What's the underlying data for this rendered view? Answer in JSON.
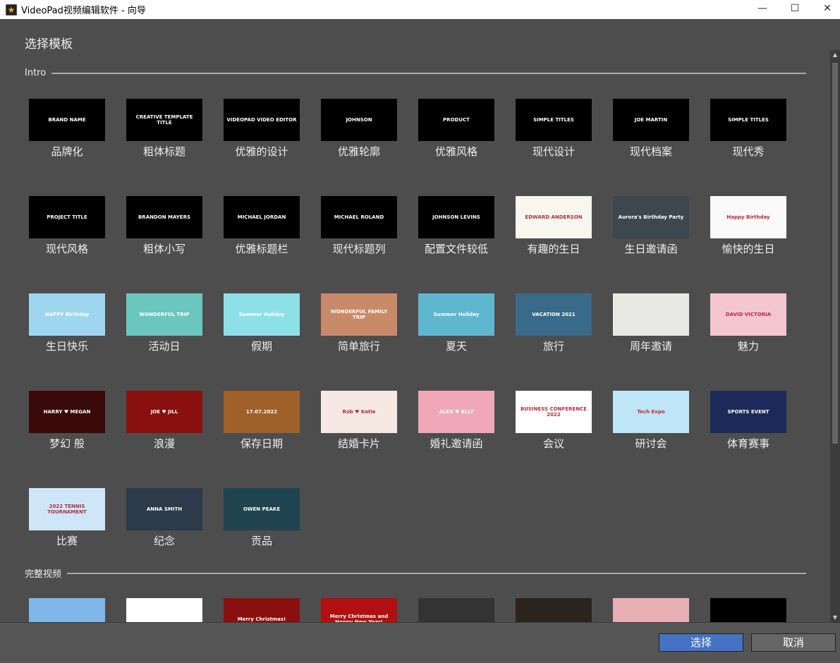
{
  "window": {
    "title": "VideoPad视频编辑软件 - 向导",
    "minimize": "—",
    "maximize": "☐",
    "close": "✕"
  },
  "heading": "选择模板",
  "sections": [
    {
      "label": "Intro"
    },
    {
      "label": "完整视频"
    }
  ],
  "intro": [
    {
      "label": "品牌化",
      "text": "BRAND NAME",
      "bg": "#000"
    },
    {
      "label": "粗体标题",
      "text": "CREATIVE TEMPLATE TITLE",
      "bg": "#000"
    },
    {
      "label": "优雅的设计",
      "text": "VIDEOPAD VIDEO EDITOR",
      "bg": "#000"
    },
    {
      "label": "优雅轮廓",
      "text": "JOHNSON",
      "bg": "#000"
    },
    {
      "label": "优雅风格",
      "text": "PRODUCT",
      "bg": "#000"
    },
    {
      "label": "现代设计",
      "text": "SIMPLE TITLES",
      "bg": "#000"
    },
    {
      "label": "现代档案",
      "text": "JOE MARTIN",
      "bg": "#000"
    },
    {
      "label": "现代秀",
      "text": "SIMPLE TITLES",
      "bg": "#000"
    },
    {
      "label": "现代风格",
      "text": "PROJECT TITLE",
      "bg": "#000"
    },
    {
      "label": "粗体小写",
      "text": "BRANDON MAYERS",
      "bg": "#000"
    },
    {
      "label": "优雅标题栏",
      "text": "MICHAEL JORDAN",
      "bg": "#000"
    },
    {
      "label": "现代标题列",
      "text": "MICHAEL ROLAND",
      "bg": "#000"
    },
    {
      "label": "配置文件较低",
      "text": "JOHNSON LEVINS",
      "bg": "#000"
    },
    {
      "label": "有趣的生日",
      "text": "EDWARD ANDERSON",
      "bg": "#f7f7f0"
    },
    {
      "label": "生日邀请函",
      "text": "Aurora's Birthday Party",
      "bg": "#3d4750"
    },
    {
      "label": "愉快的生日",
      "text": "Happy Birthday",
      "bg": "#fafafa"
    },
    {
      "label": "生日快乐",
      "text": "HAPPY Birthday",
      "bg": "#9fd6ef"
    },
    {
      "label": "活动日",
      "text": "WONDERFUL TRIP",
      "bg": "#6cc6c0"
    },
    {
      "label": "假期",
      "text": "Summer Holiday",
      "bg": "#8ee0e8"
    },
    {
      "label": "简单旅行",
      "text": "WONDERFUL FAMILY TRIP",
      "bg": "#c98a6a"
    },
    {
      "label": "夏天",
      "text": "Summer Holiday",
      "bg": "#5fb6cf"
    },
    {
      "label": "旅行",
      "text": "VACATION 2021",
      "bg": "#3a6a8a"
    },
    {
      "label": "周年邀请",
      "text": "",
      "bg": "#e8e8e4"
    },
    {
      "label": "魅力",
      "text": "DAVID VICTORIA",
      "bg": "#f4c6cf"
    },
    {
      "label": "梦幻 般",
      "text": "HARRY ♥ MEGAN",
      "bg": "#3a0a0a"
    },
    {
      "label": "浪漫",
      "text": "JOE ♥ JILL",
      "bg": "#8a0f0f"
    },
    {
      "label": "保存日期",
      "text": "17.07.2022",
      "bg": "#a0602a"
    },
    {
      "label": "结婚卡片",
      "text": "Rob ♥ Katie",
      "bg": "#f6e9e4"
    },
    {
      "label": "婚礼邀请函",
      "text": "ALEX ♥ ELLY",
      "bg": "#f0a8b8"
    },
    {
      "label": "会议",
      "text": "BUSINESS CONFERENCE 2022",
      "bg": "#ffffff"
    },
    {
      "label": "研讨会",
      "text": "Tech Expo",
      "bg": "#bfe6f6"
    },
    {
      "label": "体育赛事",
      "text": "SPORTS EVENT",
      "bg": "#1c2a5a"
    },
    {
      "label": "比赛",
      "text": "2022 TENNIS TOURNAMENT",
      "bg": "#cfe6f8"
    },
    {
      "label": "纪念",
      "text": "ANNA SMITH",
      "bg": "#2c3a4a"
    },
    {
      "label": "贡品",
      "text": "OWEN PEAKE",
      "bg": "#1f4450"
    }
  ],
  "full": [
    {
      "bg": "#7fb8e8"
    },
    {
      "bg": "#ffffff"
    },
    {
      "bg": "#8a0f0f",
      "text": "Merry Christmas!"
    },
    {
      "bg": "#b01010",
      "text": "Merry Christmas and Happy New Year!"
    },
    {
      "bg": "#333"
    },
    {
      "bg": "#2a241c"
    },
    {
      "bg": "#e8b0b4"
    },
    {
      "bg": "#000"
    }
  ],
  "buttons": {
    "select": "选择",
    "cancel": "取消"
  },
  "colors": {
    "accent": "#4472c4"
  }
}
